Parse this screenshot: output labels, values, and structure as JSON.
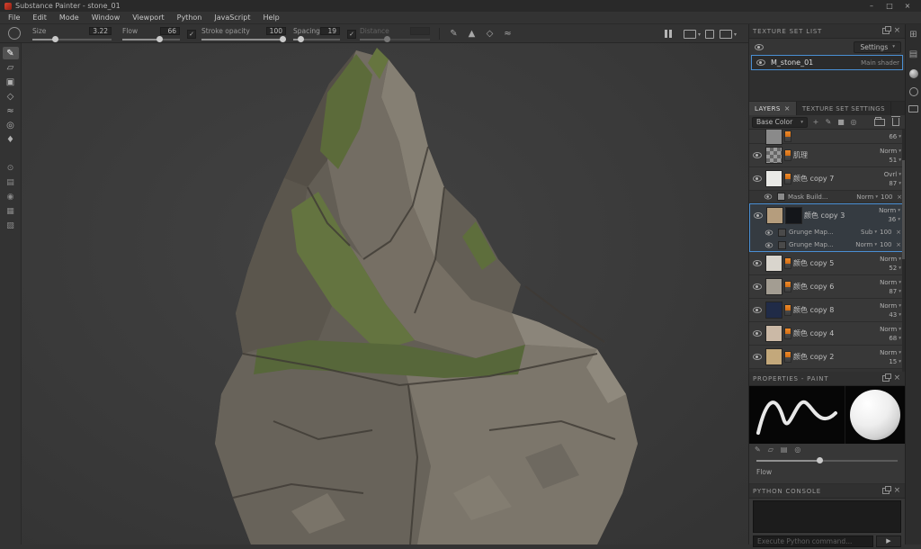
{
  "glyphs": {
    "caret_down": "▾",
    "times": "×",
    "check": "✓",
    "play": "▶",
    "minimize": "–",
    "maximize": "□",
    "pencil": "✎",
    "eraser": "▱",
    "projection": "▣",
    "polygon": "◇",
    "smudge": "≈",
    "clone": "◎",
    "picker": "♦",
    "gear": "⊙",
    "sliders": "▤",
    "user": "◉",
    "chart": "▦",
    "book": "▨",
    "grid": "⊞",
    "shelf": "▤",
    "alpha": "▲",
    "stencil": "◇",
    "lazy": "≈",
    "plus": "+",
    "fill": "■"
  },
  "window": {
    "title": "Substance Painter - stone_01"
  },
  "menubar": {
    "items": [
      "File",
      "Edit",
      "Mode",
      "Window",
      "Viewport",
      "Python",
      "JavaScript",
      "Help"
    ]
  },
  "toolbar": {
    "size": {
      "label": "Size",
      "value": "3.22"
    },
    "flow": {
      "label": "Flow",
      "value": "66"
    },
    "stroke_opacity": {
      "label": "Stroke opacity",
      "value": "100"
    },
    "spacing": {
      "label": "Spacing",
      "value": "19"
    },
    "distance": {
      "label": "Distance",
      "value": ""
    }
  },
  "texture_set_list": {
    "title": "TEXTURE SET LIST",
    "settings_label": "Settings",
    "set_name": "M_stone_01",
    "shader_label": "Main shader"
  },
  "layers_panel": {
    "tabs": [
      {
        "label": "LAYERS"
      },
      {
        "label": "TEXTURE SET SETTINGS"
      }
    ],
    "channel_selector": "Base Color",
    "rows": [
      {
        "name": "",
        "blend": "",
        "opacity": "66",
        "thumb": "#8a8a8a"
      },
      {
        "name": "肌理",
        "blend": "Norm",
        "opacity": "51",
        "thumb": "checker"
      },
      {
        "name": "颜色 copy 7",
        "blend": "Ovrl",
        "opacity": "87",
        "thumb": "#e9e9e6",
        "effects": [
          {
            "name": "Mask Build...",
            "blend": "Norm",
            "opacity": "100"
          }
        ]
      },
      {
        "name": "颜色 copy 3",
        "blend": "Norm",
        "opacity": "36",
        "thumb": "#b59d7d",
        "mask_thumb": "#14161a",
        "selected": true,
        "effects": [
          {
            "name": "Grunge Map...",
            "blend": "Sub",
            "opacity": "100"
          },
          {
            "name": "Grunge Map...",
            "blend": "Norm",
            "opacity": "100"
          }
        ]
      },
      {
        "name": "颜色 copy 5",
        "blend": "Norm",
        "opacity": "52",
        "thumb": "#d9d5cd"
      },
      {
        "name": "颜色 copy 6",
        "blend": "Norm",
        "opacity": "87",
        "thumb": "#a39d92"
      },
      {
        "name": "颜色 copy 8",
        "blend": "Norm",
        "opacity": "43",
        "thumb": "#202b47"
      },
      {
        "name": "颜色 copy 4",
        "blend": "Norm",
        "opacity": "68",
        "thumb": "#cbb9a6"
      },
      {
        "name": "颜色 copy 2",
        "blend": "Norm",
        "opacity": "15",
        "thumb": "#c3a87b"
      }
    ]
  },
  "properties_panel": {
    "title": "PROPERTIES - PAINT",
    "flow_label": "Flow"
  },
  "python_console": {
    "title": "PYTHON CONSOLE",
    "placeholder": "Execute Python command..."
  },
  "viewport": {
    "background": "#3b3b3b"
  }
}
